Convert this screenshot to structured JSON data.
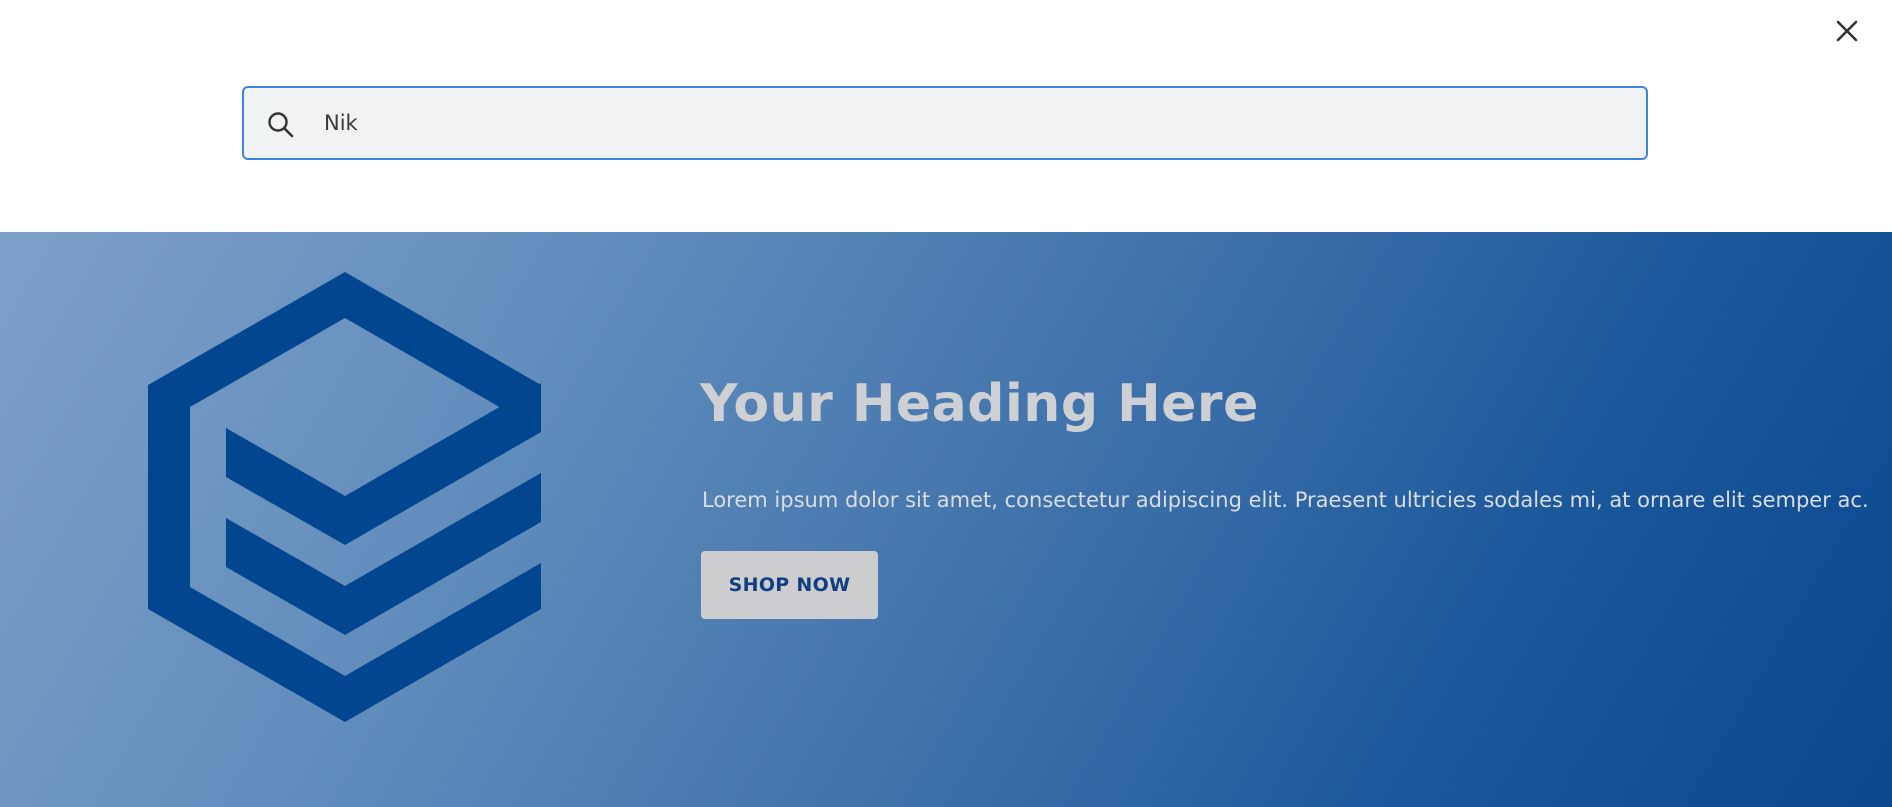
{
  "search": {
    "value": "Nik",
    "icon": "search-icon",
    "border_color": "#3d86e0"
  },
  "close": {
    "icon": "close-icon"
  },
  "hero": {
    "heading": "Your Heading Here",
    "text": "Lorem ipsum dolor sit amet, consectetur adipiscing elit. Praesent ultricies sodales mi, at ornare elit semper ac.",
    "button_label": "SHOP NOW",
    "logo_icon": "layered-hexagon-logo-icon",
    "logo_color": "#02468f"
  }
}
